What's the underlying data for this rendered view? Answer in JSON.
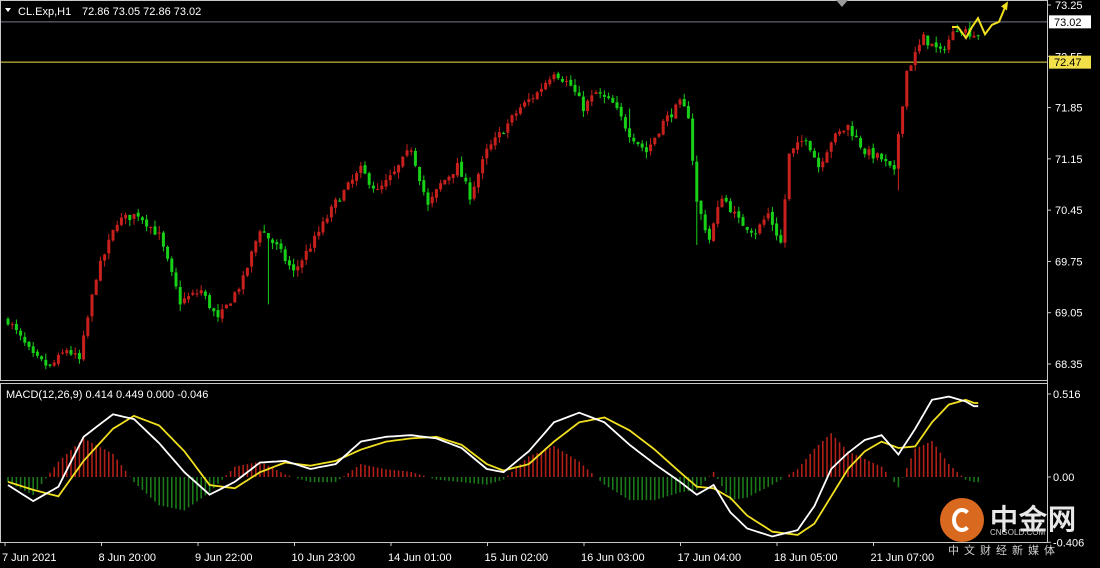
{
  "header": {
    "symbol": "CL.Exp,H1",
    "ohlc": "72.86 73.05 72.86 73.02"
  },
  "indicator": {
    "label": "MACD(12,26,9) 0.414 0.449 0.000 -0.046"
  },
  "price_markers": {
    "current": "73.02",
    "level": "72.47"
  },
  "watermark": {
    "cn": "中金网",
    "en": "CNGOLD.COM",
    "tag": "中文财经新媒体"
  },
  "colors": {
    "background": "#000000",
    "bull": "#c8201c",
    "bear": "#18d018",
    "level_line": "#f2e04a",
    "macd_line": "#ffffff",
    "signal_line": "#f0e020",
    "arrow": "#f0e020"
  },
  "chart_data": [
    {
      "type": "candlestick",
      "ylim": [
        68.0,
        73.4
      ],
      "y_ticks": [
        "73.25",
        "72.55",
        "71.85",
        "71.15",
        "70.45",
        "69.75",
        "69.05",
        "68.35"
      ],
      "x_ticks": [
        "7 Jun 2021",
        "8 Jun 20:00",
        "9 Jun 22:00",
        "10 Jun 23:00",
        "14 Jun 01:00",
        "15 Jun 02:00",
        "16 Jun 03:00",
        "17 Jun 04:00",
        "18 Jun 05:00",
        "21 Jun 07:00"
      ],
      "horizontal_level": 72.47,
      "last_price": 73.02,
      "anchors": [
        [
          0,
          68.95
        ],
        [
          6,
          68.45
        ],
        [
          10,
          68.3
        ],
        [
          14,
          68.55
        ],
        [
          17,
          68.4
        ],
        [
          21,
          69.55
        ],
        [
          26,
          70.3
        ],
        [
          31,
          70.4
        ],
        [
          36,
          70.1
        ],
        [
          41,
          69.2
        ],
        [
          46,
          69.35
        ],
        [
          50,
          68.95
        ],
        [
          56,
          69.5
        ],
        [
          60,
          70.2
        ],
        [
          64,
          69.95
        ],
        [
          68,
          69.6
        ],
        [
          73,
          70.05
        ],
        [
          78,
          70.55
        ],
        [
          84,
          71.0
        ],
        [
          88,
          70.7
        ],
        [
          92,
          70.95
        ],
        [
          96,
          71.3
        ],
        [
          100,
          70.5
        ],
        [
          103,
          70.8
        ],
        [
          107,
          71.05
        ],
        [
          110,
          70.65
        ],
        [
          114,
          71.25
        ],
        [
          118,
          71.55
        ],
        [
          122,
          71.85
        ],
        [
          126,
          72.05
        ],
        [
          130,
          72.35
        ],
        [
          134,
          72.15
        ],
        [
          137,
          71.85
        ],
        [
          140,
          72.05
        ],
        [
          144,
          71.9
        ],
        [
          148,
          71.5
        ],
        [
          152,
          71.25
        ],
        [
          156,
          71.65
        ],
        [
          160,
          71.9
        ],
        [
          162,
          71.75
        ],
        [
          164,
          70.55
        ],
        [
          167,
          70.05
        ],
        [
          170,
          70.65
        ],
        [
          174,
          70.3
        ],
        [
          178,
          70.15
        ],
        [
          181,
          70.4
        ],
        [
          184,
          70.0
        ],
        [
          186,
          71.2
        ],
        [
          190,
          71.45
        ],
        [
          193,
          71.05
        ],
        [
          196,
          71.4
        ],
        [
          200,
          71.6
        ],
        [
          204,
          71.25
        ],
        [
          208,
          71.15
        ],
        [
          211,
          70.95
        ],
        [
          212,
          71.5
        ],
        [
          214,
          72.35
        ],
        [
          218,
          72.8
        ],
        [
          222,
          72.6
        ],
        [
          226,
          72.95
        ],
        [
          230,
          72.85
        ]
      ],
      "forecast_arrow": true
    },
    {
      "type": "histogram+line",
      "title": "MACD(12,26,9)",
      "ylim": [
        -0.45,
        0.56
      ],
      "y_ticks": [
        "0.516",
        "0.00",
        "-0.406"
      ],
      "values": {
        "macd": 0.414,
        "signal": 0.449,
        "osma": 0.0,
        "diff": -0.046
      },
      "macd_anchors": [
        [
          0,
          -0.05
        ],
        [
          6,
          -0.15
        ],
        [
          12,
          -0.06
        ],
        [
          18,
          0.25
        ],
        [
          25,
          0.39
        ],
        [
          30,
          0.36
        ],
        [
          36,
          0.21
        ],
        [
          42,
          0.03
        ],
        [
          48,
          -0.11
        ],
        [
          54,
          -0.03
        ],
        [
          60,
          0.09
        ],
        [
          66,
          0.1
        ],
        [
          72,
          0.05
        ],
        [
          78,
          0.08
        ],
        [
          84,
          0.22
        ],
        [
          90,
          0.25
        ],
        [
          96,
          0.26
        ],
        [
          102,
          0.24
        ],
        [
          108,
          0.18
        ],
        [
          114,
          0.05
        ],
        [
          118,
          0.03
        ],
        [
          124,
          0.16
        ],
        [
          130,
          0.34
        ],
        [
          136,
          0.4
        ],
        [
          142,
          0.34
        ],
        [
          148,
          0.2
        ],
        [
          154,
          0.08
        ],
        [
          160,
          -0.03
        ],
        [
          164,
          -0.11
        ],
        [
          168,
          -0.05
        ],
        [
          172,
          -0.22
        ],
        [
          176,
          -0.32
        ],
        [
          182,
          -0.37
        ],
        [
          188,
          -0.33
        ],
        [
          192,
          -0.18
        ],
        [
          196,
          0.05
        ],
        [
          200,
          0.15
        ],
        [
          204,
          0.23
        ],
        [
          208,
          0.26
        ],
        [
          212,
          0.14
        ],
        [
          216,
          0.3
        ],
        [
          220,
          0.48
        ],
        [
          224,
          0.5
        ],
        [
          228,
          0.47
        ],
        [
          230,
          0.44
        ]
      ],
      "signal_anchors": [
        [
          0,
          -0.03
        ],
        [
          6,
          -0.08
        ],
        [
          12,
          -0.12
        ],
        [
          18,
          0.1
        ],
        [
          25,
          0.3
        ],
        [
          30,
          0.38
        ],
        [
          36,
          0.32
        ],
        [
          42,
          0.16
        ],
        [
          48,
          -0.05
        ],
        [
          54,
          -0.07
        ],
        [
          60,
          0.03
        ],
        [
          66,
          0.09
        ],
        [
          72,
          0.07
        ],
        [
          78,
          0.1
        ],
        [
          84,
          0.17
        ],
        [
          90,
          0.22
        ],
        [
          96,
          0.24
        ],
        [
          102,
          0.25
        ],
        [
          108,
          0.2
        ],
        [
          114,
          0.08
        ],
        [
          118,
          0.04
        ],
        [
          124,
          0.08
        ],
        [
          130,
          0.22
        ],
        [
          136,
          0.34
        ],
        [
          142,
          0.37
        ],
        [
          148,
          0.29
        ],
        [
          154,
          0.17
        ],
        [
          160,
          0.03
        ],
        [
          164,
          -0.06
        ],
        [
          168,
          -0.07
        ],
        [
          172,
          -0.13
        ],
        [
          176,
          -0.24
        ],
        [
          182,
          -0.34
        ],
        [
          188,
          -0.36
        ],
        [
          192,
          -0.29
        ],
        [
          196,
          -0.12
        ],
        [
          200,
          0.05
        ],
        [
          204,
          0.16
        ],
        [
          208,
          0.22
        ],
        [
          212,
          0.18
        ],
        [
          216,
          0.19
        ],
        [
          220,
          0.34
        ],
        [
          224,
          0.45
        ],
        [
          228,
          0.48
        ],
        [
          230,
          0.46
        ]
      ]
    }
  ]
}
